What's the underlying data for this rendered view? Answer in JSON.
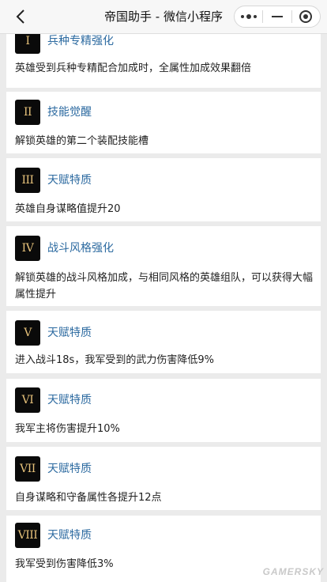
{
  "nav": {
    "title": "帝国助手 - 微信小程序"
  },
  "items": [
    {
      "numeral": "I",
      "title": "兵种专精强化",
      "desc": "英雄受到兵种专精配合加成时，全属性加成效果翻倍"
    },
    {
      "numeral": "II",
      "title": "技能觉醒",
      "desc": "解锁英雄的第二个装配技能槽"
    },
    {
      "numeral": "III",
      "title": "天赋特质",
      "desc": "英雄自身谋略值提升20"
    },
    {
      "numeral": "IV",
      "title": "战斗风格强化",
      "desc": "解锁英雄的战斗风格加成，与相同风格的英雄组队，可以获得大幅属性提升"
    },
    {
      "numeral": "V",
      "title": "天赋特质",
      "desc": "进入战斗18s，我军受到的武力伤害降低9%"
    },
    {
      "numeral": "VI",
      "title": "天赋特质",
      "desc": "我军主将伤害提升10%"
    },
    {
      "numeral": "VII",
      "title": "天赋特质",
      "desc": "自身谋略和守备属性各提升12点"
    },
    {
      "numeral": "VIII",
      "title": "天赋特质",
      "desc": "我军受到伤害降低3%"
    }
  ],
  "watermark": "GAMERSKY"
}
